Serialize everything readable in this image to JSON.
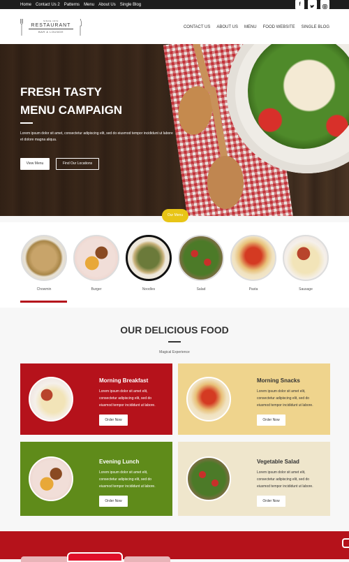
{
  "topbar": {
    "links": [
      "Home",
      "Contact Us 2",
      "Patterns",
      "Menu",
      "About Us",
      "Single Blog"
    ],
    "social_icons": [
      "facebook-icon",
      "twitter-icon",
      "instagram-icon"
    ]
  },
  "logo": {
    "since": "SINCE 1972",
    "name": "RESTAURANT",
    "tagline": "BAR & LOUNGE"
  },
  "nav": [
    "CONTACT US",
    "ABOUT US",
    "MENU",
    "FOOD WEBSITE",
    "SINGLE BLOG"
  ],
  "hero": {
    "title_line1": "FRESH TASTY",
    "title_line2": "MENU CAMPAIGN",
    "text": "Lorem ipsum dolor sit amet, consectetur adipiscing elit, sed do eiusmod tempor incididunt ut labore et dolore magna aliqua.",
    "btn_view_menu": "View Menu",
    "btn_locations": "Find Our Locations"
  },
  "menu_pill": "Our Menu",
  "categories": {
    "items": [
      {
        "label": "Chowmin",
        "active": false
      },
      {
        "label": "Burger",
        "active": false
      },
      {
        "label": "Noodles",
        "active": true
      },
      {
        "label": "Salad",
        "active": false
      },
      {
        "label": "Pasta",
        "active": false
      },
      {
        "label": "Sausage",
        "active": false
      }
    ]
  },
  "section": {
    "title": "OUR DELICIOUS FOOD",
    "subtitle": "Magical Experience"
  },
  "cards": [
    {
      "title": "Morning Breakfast",
      "text": "Lorem ipsum dolor sit amet elit, consectetur adipiscing elit, sed do eiusmod tempor incididunt ut labore.",
      "button": "Order Now",
      "bg": "#b5121b"
    },
    {
      "title": "Morning Snacks",
      "text": "Lorem ipsum dolor sit amet elit, consectetur adipiscing elit, sed do eiusmod tempor incididunt ut labore.",
      "button": "Order Now",
      "bg": "#efd48d"
    },
    {
      "title": "Evening Lunch",
      "text": "Lorem ipsum dolor sit amet elit, consectetur adipiscing elit, sed do eiusmod tempor incididunt ut labore.",
      "button": "Order Now",
      "bg": "#5f8b1a"
    },
    {
      "title": "Vegetable Salad",
      "text": "Lorem ipsum dolor sit amet elit, consectetur adipiscing elit, sed do eiusmod tempor incididunt ut labore.",
      "button": "Order Now",
      "bg": "#efe6cc"
    }
  ],
  "colors": {
    "accent_red": "#b5121b",
    "accent_yellow": "#e8c516",
    "topbar": "#1d1d1d"
  }
}
